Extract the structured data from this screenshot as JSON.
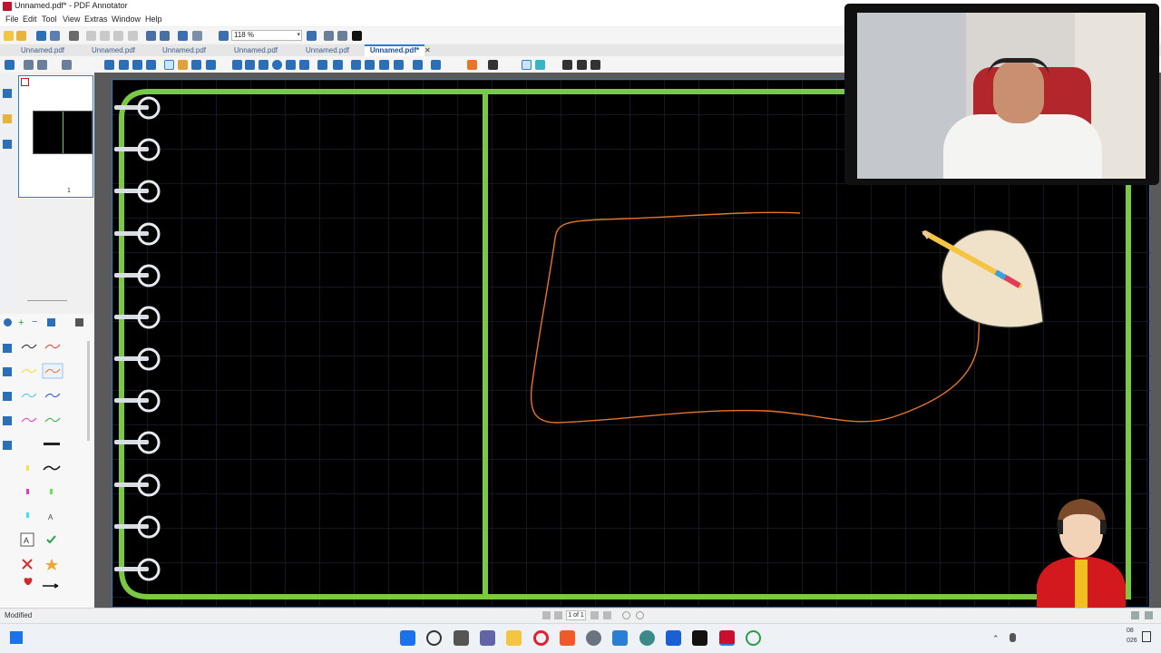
{
  "window": {
    "title": "Unnamed.pdf* - PDF Annotator"
  },
  "menu": [
    "File",
    "Edit",
    "Tool",
    "View",
    "Extras",
    "Window",
    "Help"
  ],
  "toolbar": {
    "zoom": "118 %"
  },
  "tabs": [
    {
      "label": "Unnamed.pdf",
      "active": false
    },
    {
      "label": "Unnamed.pdf",
      "active": false
    },
    {
      "label": "Unnamed.pdf",
      "active": false
    },
    {
      "label": "Unnamed.pdf",
      "active": false
    },
    {
      "label": "Unnamed.pdf",
      "active": false
    },
    {
      "label": "Unnamed.pdf*",
      "active": true
    }
  ],
  "tab_close": "✕",
  "thumbnail": {
    "page_number": "1"
  },
  "status": {
    "text": "Modified",
    "page_info": "1 of 1"
  },
  "colors": {
    "notebook_border": "#7ac943",
    "ink": "#e8742a",
    "page_bg": "#000000",
    "grid": "#233040",
    "accent": "#2a7fd4"
  },
  "taskbar": {
    "icons": [
      "windows-start-icon",
      "search-icon",
      "task-view-icon",
      "chat-icon",
      "file-explorer-icon",
      "opera-icon",
      "brave-icon",
      "settings-icon",
      "store-icon",
      "edge-icon",
      "chrome-icon",
      "tiktok-icon",
      "pdf-annotator-icon",
      "xbox-icon"
    ],
    "clock_time": "08",
    "clock_date": "026"
  }
}
